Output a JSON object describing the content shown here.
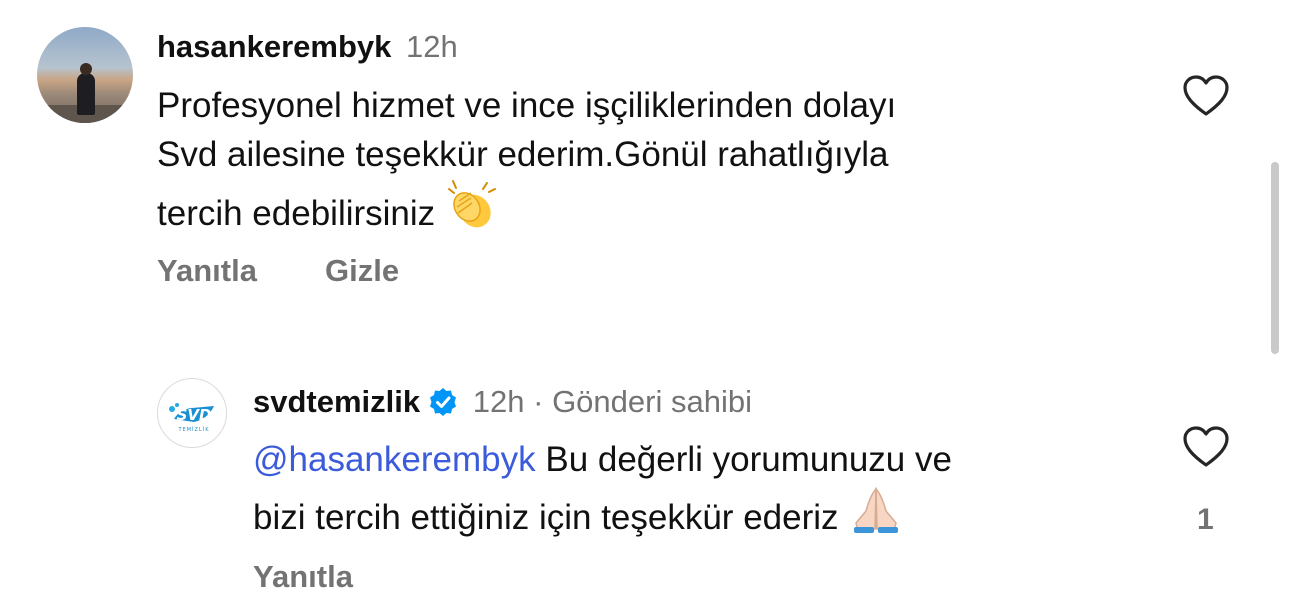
{
  "comments": [
    {
      "username": "hasankerembyk",
      "time": "12h",
      "lines": [
        "Profesyonel hizmet ve ince işçiliklerinden dolayı",
        "Svd ailesine teşekkür ederim.Gönül rahatlığıyla",
        "tercih edebilirsiniz"
      ],
      "emoji": "clapping-hands",
      "actions": {
        "reply": "Yanıtla",
        "hide": "Gizle"
      }
    },
    {
      "username": "svdtemizlik",
      "verified": true,
      "time": "12h",
      "separator": "·",
      "role": "Gönderi sahibi",
      "mention": "@hasankerembyk",
      "lines": [
        "Bu değerli yorumunuzu ve",
        "bizi tercih ettiğiniz için teşekkür ederiz"
      ],
      "emoji": "folded-hands",
      "like_count": "1",
      "actions": {
        "reply": "Yanıtla"
      },
      "avatar_logo_text": "SVD",
      "avatar_logo_subtext": "TEMİZLİK"
    }
  ],
  "colors": {
    "text": "#111111",
    "meta": "#737373",
    "mention": "#3b5bdb",
    "verified": "#0095f6"
  }
}
